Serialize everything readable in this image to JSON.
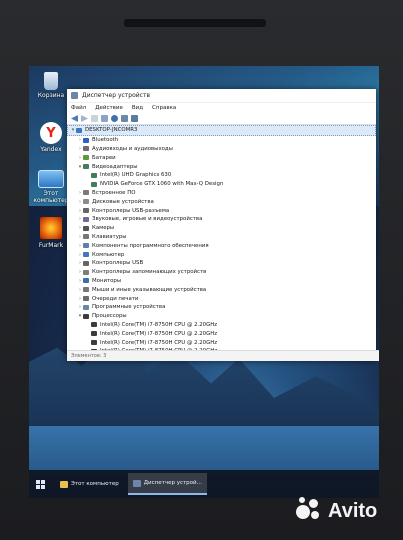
{
  "colors": {
    "accent": "#2f6fba",
    "selection": "#dbe9f8"
  },
  "desktop": {
    "icons": [
      {
        "label": "Корзина",
        "icon": "recycle-bin-icon"
      },
      {
        "label": "Yandex",
        "icon": "yandex-browser-icon"
      },
      {
        "label": "Этот компьютер",
        "icon": "this-pc-icon"
      },
      {
        "label": "FurMark",
        "icon": "furmark-icon"
      }
    ]
  },
  "window": {
    "title": "Диспетчер устройств",
    "menu": [
      "Файл",
      "Действие",
      "Вид",
      "Справка"
    ],
    "tree": [
      {
        "label": "DESKTOP-JNCOMR3",
        "level": 0,
        "arrow": "▾",
        "icon": "computer-icon"
      },
      {
        "label": "Bluetooth",
        "level": 1,
        "arrow": "›",
        "icon": "bluetooth-icon"
      },
      {
        "label": "Аудиовходы и аудиовыходы",
        "level": 1,
        "arrow": "›",
        "icon": "audio-icon"
      },
      {
        "label": "Батареи",
        "level": 1,
        "arrow": "›",
        "icon": "battery-icon"
      },
      {
        "label": "Видеоадаптеры",
        "level": 1,
        "arrow": "▾",
        "icon": "display-adapter-icon"
      },
      {
        "label": "Intel(R) UHD Graphics 630",
        "level": 2,
        "arrow": "",
        "icon": "display-adapter-icon"
      },
      {
        "label": "NVIDIA GeForce GTX 1060 with Max-Q Design",
        "level": 2,
        "arrow": "",
        "icon": "display-adapter-icon"
      },
      {
        "label": "Встроенное ПО",
        "level": 1,
        "arrow": "›",
        "icon": "firmware-icon"
      },
      {
        "label": "Дисковые устройства",
        "level": 1,
        "arrow": "›",
        "icon": "disk-icon"
      },
      {
        "label": "Контроллеры USB-разъема",
        "level": 1,
        "arrow": "›",
        "icon": "usb-icon"
      },
      {
        "label": "Звуковые, игровые и видеоустройства",
        "level": 1,
        "arrow": "›",
        "icon": "sound-icon"
      },
      {
        "label": "Камеры",
        "level": 1,
        "arrow": "›",
        "icon": "camera-icon"
      },
      {
        "label": "Клавиатуры",
        "level": 1,
        "arrow": "›",
        "icon": "keyboard-icon"
      },
      {
        "label": "Компоненты программного обеспечения",
        "level": 1,
        "arrow": "›",
        "icon": "software-component-icon"
      },
      {
        "label": "Компьютер",
        "level": 1,
        "arrow": "›",
        "icon": "computer-icon"
      },
      {
        "label": "Контроллеры USB",
        "level": 1,
        "arrow": "›",
        "icon": "usb-icon"
      },
      {
        "label": "Контроллеры запоминающих устройств",
        "level": 1,
        "arrow": "›",
        "icon": "storage-controller-icon"
      },
      {
        "label": "Мониторы",
        "level": 1,
        "arrow": "›",
        "icon": "monitor-icon"
      },
      {
        "label": "Мыши и иные указывающие устройства",
        "level": 1,
        "arrow": "›",
        "icon": "mouse-icon"
      },
      {
        "label": "Очереди печати",
        "level": 1,
        "arrow": "›",
        "icon": "print-queue-icon"
      },
      {
        "label": "Программные устройства",
        "level": 1,
        "arrow": "›",
        "icon": "software-device-icon"
      },
      {
        "label": "Процессоры",
        "level": 1,
        "arrow": "▾",
        "icon": "processor-icon"
      },
      {
        "label": "Intel(R) Core(TM) i7-8750H CPU @ 2.20GHz",
        "level": 2,
        "arrow": "",
        "icon": "processor-icon"
      },
      {
        "label": "Intel(R) Core(TM) i7-8750H CPU @ 2.20GHz",
        "level": 2,
        "arrow": "",
        "icon": "processor-icon"
      },
      {
        "label": "Intel(R) Core(TM) i7-8750H CPU @ 2.20GHz",
        "level": 2,
        "arrow": "",
        "icon": "processor-icon"
      },
      {
        "label": "Intel(R) Core(TM) i7-8750H CPU @ 2.20GHz",
        "level": 2,
        "arrow": "",
        "icon": "processor-icon"
      }
    ],
    "status": "Элементов: 3"
  },
  "taskbar": {
    "items": [
      {
        "label": "Этот компьютер",
        "icon": "file-explorer-icon",
        "active": false
      },
      {
        "label": "Диспетчер устрой...",
        "icon": "device-manager-icon",
        "active": true
      }
    ]
  },
  "watermark": {
    "text": "Avito"
  }
}
